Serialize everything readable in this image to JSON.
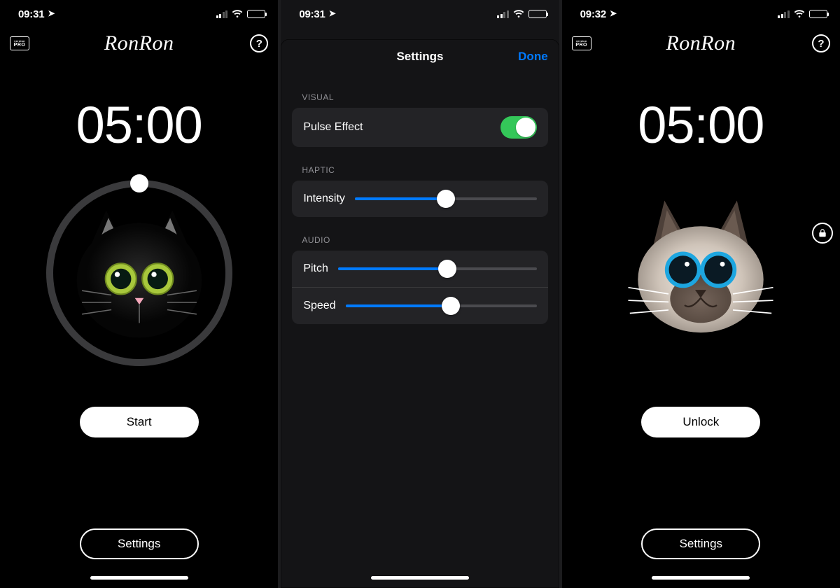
{
  "status": {
    "time_a": "09:31",
    "time_b": "09:31",
    "time_c": "09:32"
  },
  "app": {
    "title": "RonRon",
    "pro_badge_top": "version",
    "pro_badge_bottom": "PRO",
    "help_symbol": "?"
  },
  "main": {
    "timer_a": "05:00",
    "timer_c": "05:00",
    "primary_a": "Start",
    "primary_c": "Unlock",
    "settings_label": "Settings"
  },
  "settings": {
    "title": "Settings",
    "done": "Done",
    "sections": [
      {
        "header": "VISUAL",
        "rows": [
          {
            "label": "Pulse Effect",
            "type": "switch",
            "on": true
          }
        ]
      },
      {
        "header": "HAPTIC",
        "rows": [
          {
            "label": "Intensity",
            "type": "slider",
            "value": 0.5
          }
        ]
      },
      {
        "header": "AUDIO",
        "rows": [
          {
            "label": "Pitch",
            "type": "slider",
            "value": 0.55
          },
          {
            "label": "Speed",
            "type": "slider",
            "value": 0.55
          }
        ]
      }
    ]
  },
  "colors": {
    "accent": "#007aff",
    "switch_on": "#34c759"
  }
}
